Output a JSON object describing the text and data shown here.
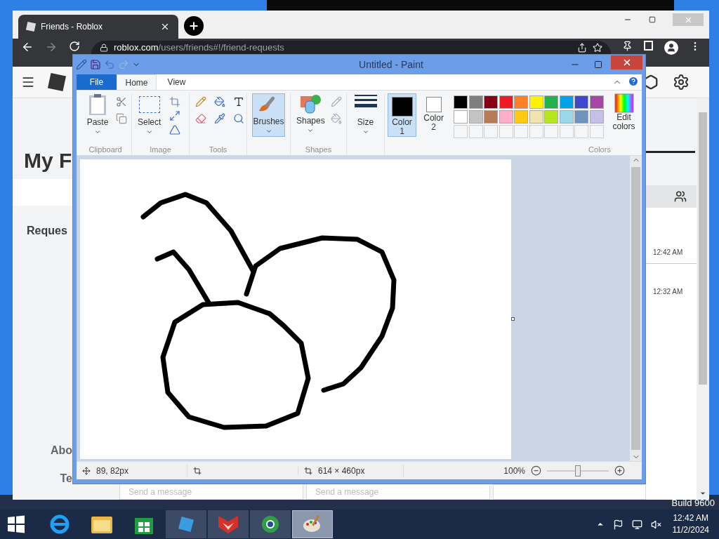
{
  "desktop": {
    "build_text": "Build 9600"
  },
  "browser": {
    "tab": {
      "title": "Friends - Roblox"
    },
    "address": {
      "host": "roblox.com",
      "path": "/users/friends#!/friend-requests"
    },
    "page": {
      "heading": "My F",
      "section": "Reques",
      "times": [
        "12:42 AM",
        "12:32 AM"
      ],
      "footer_links": [
        "Abo",
        "Te"
      ],
      "message_fields": [
        {
          "placeholder": "Send a message"
        },
        {
          "placeholder": "Send a message"
        }
      ]
    }
  },
  "paint": {
    "title": "Untitled - Paint",
    "ribbon_tabs": [
      {
        "label": "File",
        "kind": "file",
        "selected": false
      },
      {
        "label": "Home",
        "kind": "tab",
        "selected": true
      },
      {
        "label": "View",
        "kind": "tab",
        "selected": false
      }
    ],
    "groups": {
      "clipboard": "Clipboard",
      "image": "Image",
      "tools": "Tools",
      "shapes": "Shapes",
      "colors": "Colors"
    },
    "buttons": {
      "paste": "Paste",
      "select": "Select",
      "brushes": {
        "label": "Brushes",
        "selected": true
      },
      "shapes": "Shapes",
      "size": "Size",
      "edit_colors": "Edit colors"
    },
    "color_slots": [
      {
        "label": "Color 1",
        "color": "#000000",
        "selected": true
      },
      {
        "label": "Color 2",
        "color": "#ffffff",
        "selected": false
      }
    ],
    "palette": [
      {
        "color": "#000000"
      },
      {
        "color": "#7f7f7f"
      },
      {
        "color": "#880015"
      },
      {
        "color": "#ed1c24"
      },
      {
        "color": "#ff7f27"
      },
      {
        "color": "#fff200"
      },
      {
        "color": "#22b14c"
      },
      {
        "color": "#00a2e8"
      },
      {
        "color": "#3f48cc"
      },
      {
        "color": "#a349a4"
      },
      {
        "color": "#ffffff"
      },
      {
        "color": "#c3c3c3"
      },
      {
        "color": "#b97a57"
      },
      {
        "color": "#ffaec9"
      },
      {
        "color": "#ffc90e"
      },
      {
        "color": "#efe4b0"
      },
      {
        "color": "#b5e61d"
      },
      {
        "color": "#99d9ea"
      },
      {
        "color": "#7092be"
      },
      {
        "color": "#c8bfe7"
      }
    ],
    "status": {
      "position": "89, 82px",
      "size": "614 × 460px",
      "zoom": "100%",
      "zoom_slider": {
        "level": 0.5
      }
    }
  },
  "taskbar": {
    "apps": [
      {
        "kind": "browser",
        "selected": false
      },
      {
        "kind": "folder",
        "selected": false
      },
      {
        "kind": "store",
        "selected": false
      },
      {
        "kind": "roblox",
        "selected": false
      },
      {
        "kind": "fox",
        "selected": false
      },
      {
        "kind": "chrome",
        "selected": false
      },
      {
        "kind": "paint",
        "selected": true
      }
    ],
    "time": "12:42 AM",
    "date": "11/2/2024"
  }
}
